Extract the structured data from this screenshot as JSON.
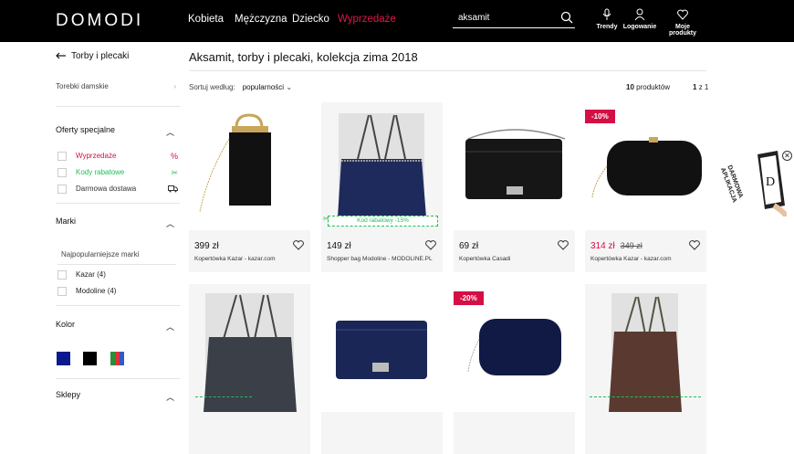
{
  "header": {
    "logo": "DOMODI",
    "nav": [
      {
        "label": "Kobieta",
        "color": "#ffffff"
      },
      {
        "label": "Mężczyzna",
        "color": "#ffffff"
      },
      {
        "label": "Dziecko",
        "color": "#ffffff"
      },
      {
        "label": "Wyprzedaże",
        "color": "#e2164a"
      }
    ],
    "search_value": "aksamit",
    "utils": [
      {
        "label": "Trendy",
        "icon": "microphone-icon"
      },
      {
        "label": "Logowanie",
        "icon": "user-icon"
      },
      {
        "label": "Moje produkty",
        "icon": "heart-icon"
      }
    ]
  },
  "sidebar": {
    "back_label": "Torby i plecaki",
    "category": "Torebki damskie",
    "offers_title": "Oferty specjalne",
    "offers": [
      {
        "label": "Wyprzedaże",
        "icon": "percent-icon",
        "color": "#d40f45"
      },
      {
        "label": "Kody rabatowe",
        "icon": "scissors-percent-icon",
        "color": "#1fbf55"
      },
      {
        "label": "Darmowa dostawa",
        "icon": "truck-icon",
        "color": "#333333"
      }
    ],
    "brands_title": "Marki",
    "brands_subtitle": "Najpopularniejsze marki",
    "brands": [
      {
        "label": "Kazar (4)"
      },
      {
        "label": "Modoline (4)"
      }
    ],
    "color_title": "Kolor",
    "colors": [
      "#0a1a8c",
      "#000000",
      "multicolor"
    ],
    "shops_title": "Sklepy"
  },
  "main": {
    "title": "Aksamit, torby i plecaki, kolekcja zima 2018",
    "sort_label": "Sortuj według:",
    "sort_value": "popularności",
    "count_num": "10",
    "count_label": "produktów",
    "page_num": "1",
    "page_label": "z 1",
    "products": [
      {
        "price": "399 zł",
        "old_price": "",
        "name": "Kopertówka Kazar - kazar.com",
        "badge": "",
        "promo": ""
      },
      {
        "price": "149 zł",
        "old_price": "",
        "name": "Shopper bag Modoline - MODOLINE.PL",
        "badge": "",
        "promo": "Kod rabatowy -15%"
      },
      {
        "price": "69 zł",
        "old_price": "",
        "name": "Kopertówka Casadi",
        "badge": "",
        "promo": ""
      },
      {
        "price": "314 zł",
        "old_price": "349 zł",
        "name": "Kopertówka Kazar - kazar.com",
        "badge": "-10%",
        "promo": ""
      },
      {
        "price": "",
        "old_price": "",
        "name": "",
        "badge": "",
        "promo": ""
      },
      {
        "price": "",
        "old_price": "",
        "name": "",
        "badge": "",
        "promo": ""
      },
      {
        "price": "",
        "old_price": "",
        "name": "",
        "badge": "-20%",
        "promo": ""
      },
      {
        "price": "",
        "old_price": "",
        "name": "",
        "badge": "",
        "promo": ""
      }
    ]
  },
  "side_promo": {
    "line1": "DARMOWA",
    "line2": "APLIKACJA"
  }
}
